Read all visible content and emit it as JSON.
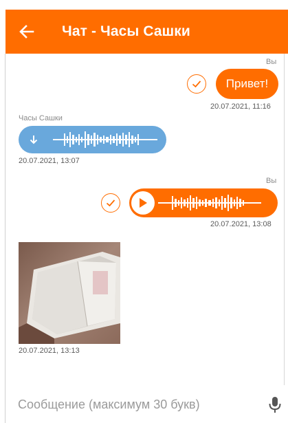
{
  "header": {
    "title": "Чат - Часы Сашки",
    "back_icon": "arrow-left-icon"
  },
  "theme": {
    "accent": "#ff6d00",
    "incoming_bubble": "#69a8dc"
  },
  "messages": [
    {
      "sender": "Вы",
      "type": "text",
      "text": "Привет!",
      "time": "20.07.2021, 11:16",
      "status_icon": "check-circle-icon"
    },
    {
      "sender": "Часы Сашки",
      "type": "voice",
      "action_icon": "download-icon",
      "time": "20.07.2021, 13:07"
    },
    {
      "sender": "Вы",
      "type": "voice",
      "action_icon": "play-icon",
      "time": "20.07.2021, 13:08",
      "status_icon": "check-circle-icon"
    },
    {
      "type": "image",
      "time": "20.07.2021, 13:13"
    }
  ],
  "composer": {
    "placeholder": "Сообщение (максимум 30 букв)",
    "mic_icon": "microphone-icon"
  }
}
